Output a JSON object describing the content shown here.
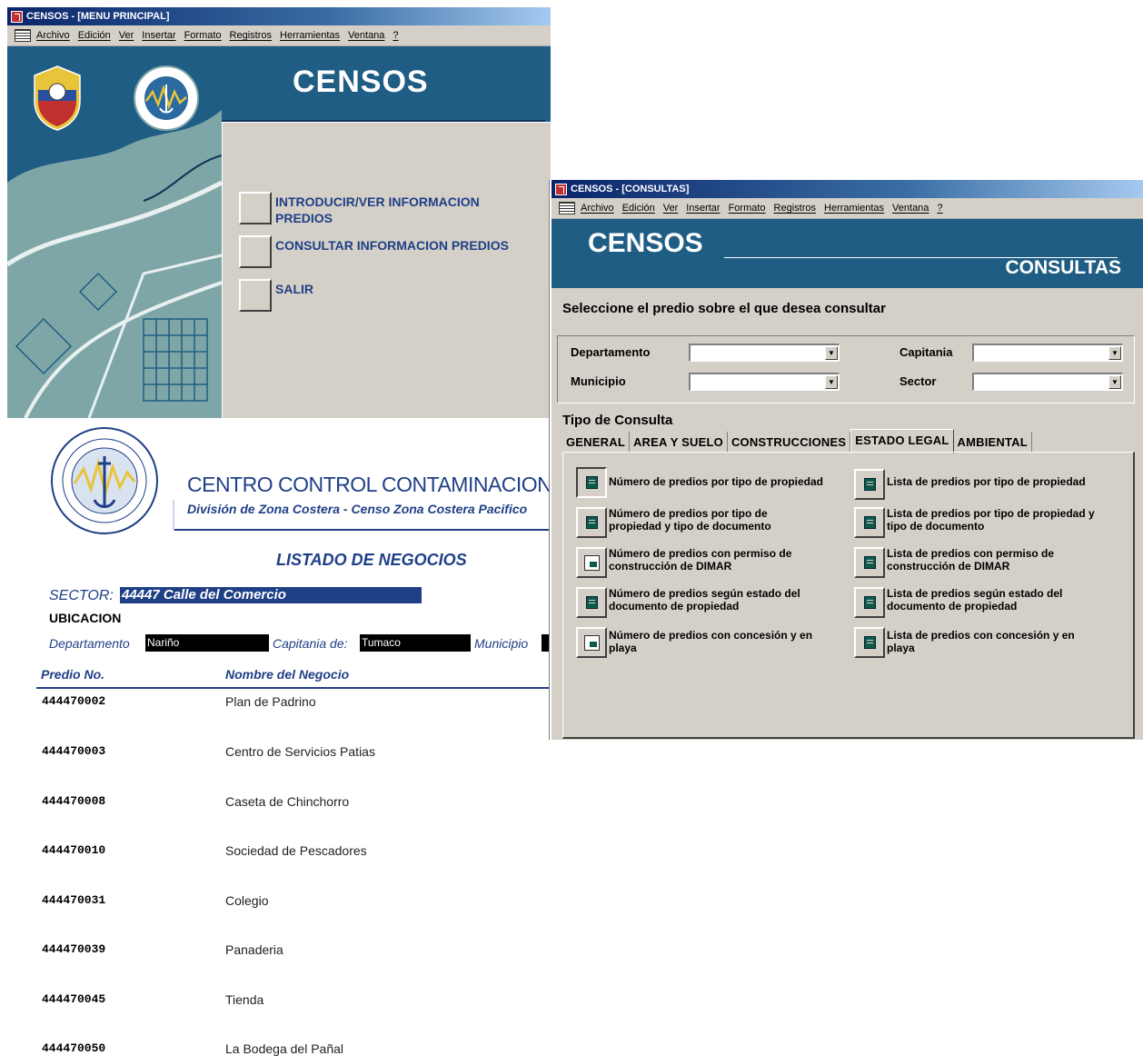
{
  "window_main": {
    "title": "CENSOS - [MENU PRINCIPAL]",
    "menu": [
      "Archivo",
      "Edición",
      "Ver",
      "Insertar",
      "Formato",
      "Registros",
      "Herramientas",
      "Ventana",
      "?"
    ],
    "banner_title": "CENSOS",
    "buttons": [
      {
        "line1": "INTRODUCIR/VER INFORMACION",
        "line2": "PREDIOS"
      },
      {
        "line1": "CONSULTAR INFORMACION PREDIOS",
        "line2": ""
      },
      {
        "line1": "SALIR",
        "line2": ""
      }
    ]
  },
  "window_consultas": {
    "title": "CENSOS - [CONSULTAS]",
    "menu": [
      "Archivo",
      "Edición",
      "Ver",
      "Insertar",
      "Formato",
      "Registros",
      "Herramientas",
      "Ventana",
      "?"
    ],
    "banner_title": "CENSOS",
    "banner_subtitle": "CONSULTAS",
    "instruction": "Seleccione el predio sobre el que desea consultar",
    "filters": {
      "departamento_label": "Departamento",
      "municipio_label": "Municipio",
      "capitania_label": "Capitania",
      "sector_label": "Sector",
      "departamento_value": "",
      "municipio_value": "",
      "capitania_value": "",
      "sector_value": ""
    },
    "tipo_label": "Tipo de Consulta",
    "tabs": [
      "GENERAL",
      "AREA Y SUELO",
      "CONSTRUCCIONES",
      "ESTADO LEGAL",
      "AMBIENTAL"
    ],
    "active_tab": "ESTADO LEGAL",
    "left_queries": [
      {
        "line1": "Número de predios por tipo de propiedad",
        "line2": "",
        "icon": "report-icon"
      },
      {
        "line1": "Número de predios por tipo de",
        "line2": "propiedad y tipo de documento",
        "icon": "report-icon"
      },
      {
        "line1": "Número de predios con permiso de",
        "line2": "construcción de DIMAR",
        "icon": "chart-icon"
      },
      {
        "line1": "Número de predios según estado del",
        "line2": "documento de propiedad",
        "icon": "report-icon"
      },
      {
        "line1": "Número de predios con concesión y en",
        "line2": "playa",
        "icon": "chart-icon"
      }
    ],
    "right_queries": [
      {
        "line1": "Lista de predios por tipo de propiedad",
        "line2": "",
        "icon": "report-icon"
      },
      {
        "line1": "Lista de predios por tipo de propiedad y",
        "line2": "tipo de documento",
        "icon": "report-icon"
      },
      {
        "line1": "Lista de predios con permiso de",
        "line2": "construcción de DIMAR",
        "icon": "report-icon"
      },
      {
        "line1": "Lista de predios según estado del",
        "line2": "documento de propiedad",
        "icon": "report-icon"
      },
      {
        "line1": "Lista de predios con concesión y en",
        "line2": "playa",
        "icon": "report-icon"
      }
    ]
  },
  "report": {
    "organization": "CENTRO CONTROL CONTAMINACION DEL PA",
    "division": "División de Zona Costera - Censo Zona Costera Pacifico",
    "title": "LISTADO DE NEGOCIOS",
    "sector_label": "SECTOR:",
    "sector_value": "44447 Calle del Comercio",
    "ubicacion_label": "UBICACION",
    "departamento_label": "Departamento",
    "departamento_value": "Nariño",
    "capitania_label": "Capitania de:",
    "capitania_value": "Tumaco",
    "municipio_label": "Municipio",
    "columns": [
      "Predio No.",
      "Nombre del Negocio"
    ],
    "rows": [
      {
        "id": "444470002",
        "name": "Plan de Padrino"
      },
      {
        "id": "444470003",
        "name": "Centro de Servicios Patias"
      },
      {
        "id": "444470008",
        "name": "Caseta de Chinchorro"
      },
      {
        "id": "444470010",
        "name": "Sociedad de Pescadores"
      },
      {
        "id": "444470031",
        "name": "Colegio"
      },
      {
        "id": "444470039",
        "name": "Panaderia"
      },
      {
        "id": "444470045",
        "name": "Tienda"
      },
      {
        "id": "444470050",
        "name": "La Bodega del Pañal"
      }
    ]
  },
  "colors": {
    "banner_blue": "#1f5d84",
    "text_blue": "#1f3f86",
    "window_gray": "#d4d0c8"
  }
}
